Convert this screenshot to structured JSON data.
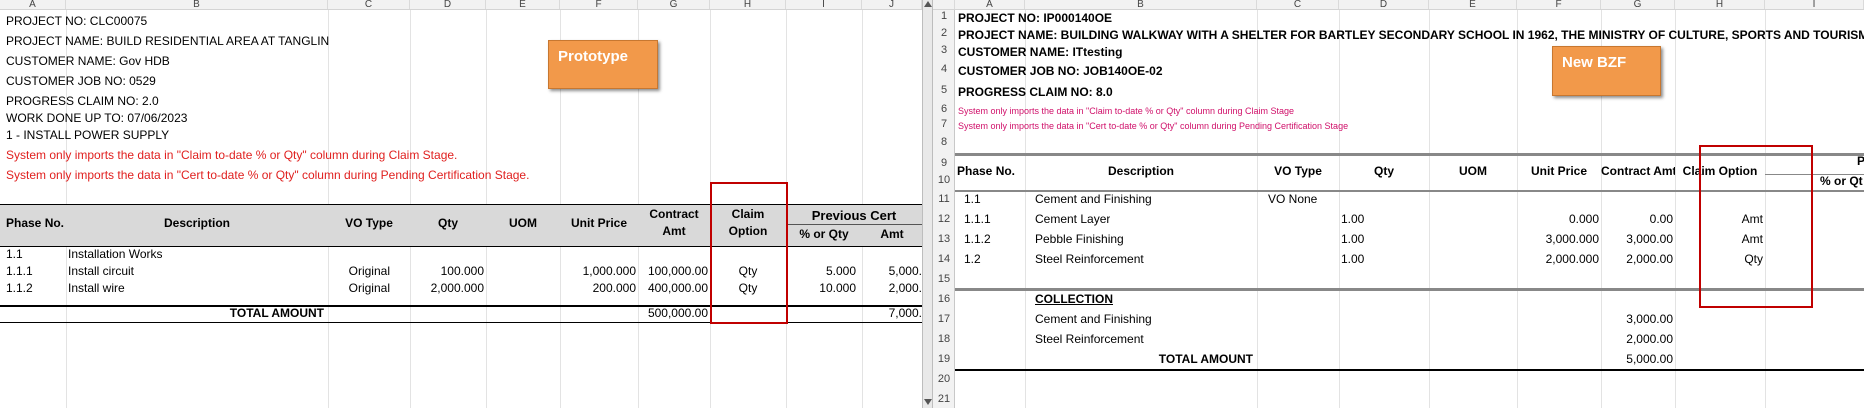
{
  "left": {
    "columns": [
      "A",
      "B",
      "C",
      "D",
      "E",
      "F",
      "G",
      "H",
      "I",
      "J"
    ],
    "info": [
      "PROJECT NO: CLC00075",
      "PROJECT NAME: BUILD RESIDENTIAL AREA AT TANGLIN",
      "CUSTOMER NAME: Gov HDB",
      "CUSTOMER JOB NO: 0529",
      "PROGRESS CLAIM NO: 2.0",
      "WORK DONE UP TO: 07/06/2023",
      "1 - INSTALL POWER SUPPLY"
    ],
    "notes": [
      "System only imports the data in \"Claim to-date % or Qty\" column during Claim Stage.",
      "System only imports the data in \"Cert to-date % or Qty\" column during Pending Certification Stage."
    ],
    "callout": "Prototype",
    "headers": {
      "phase": "Phase No.",
      "description": "Description",
      "vo_type": "VO Type",
      "qty": "Qty",
      "uom": "UOM",
      "unit_price": "Unit Price",
      "contract_1": "Contract",
      "contract_2": "Amt",
      "claim_1": "Claim",
      "claim_2": "Option",
      "prev_cert": "Previous Cert",
      "pct_qty": "% or Qty",
      "amt": "Amt"
    },
    "rows": [
      {
        "phase": "1.1",
        "description": "Installation Works",
        "vo_type": "",
        "qty": "",
        "uom": "",
        "unit_price": "",
        "contract_amt": "",
        "claim_option": "",
        "pct": "",
        "amt": ""
      },
      {
        "phase": "1.1.1",
        "description": "Install circuit",
        "vo_type": "Original",
        "qty": "100.000",
        "uom": "",
        "unit_price": "1,000.000",
        "contract_amt": "100,000.00",
        "claim_option": "Qty",
        "pct": "5.000",
        "amt": "5,000."
      },
      {
        "phase": "1.1.2",
        "description": "Install wire",
        "vo_type": "Original",
        "qty": "2,000.000",
        "uom": "",
        "unit_price": "200.000",
        "contract_amt": "400,000.00",
        "claim_option": "Qty",
        "pct": "10.000",
        "amt": "2,000."
      }
    ],
    "total_label": "TOTAL AMOUNT",
    "total_contract": "500,000.00",
    "total_amt": "7,000."
  },
  "right": {
    "columns": [
      "A",
      "B",
      "C",
      "D",
      "E",
      "F",
      "G",
      "H",
      "I"
    ],
    "row_numbers": [
      "1",
      "2",
      "3",
      "4",
      "5",
      "6",
      "7",
      "8",
      "9",
      "10",
      "11",
      "12",
      "13",
      "14",
      "15",
      "16",
      "17",
      "18",
      "19",
      "20",
      "21"
    ],
    "info": [
      "PROJECT NO: IP000140OE",
      "PROJECT NAME: BUILDING WALKWAY WITH A SHELTER FOR BARTLEY SECONDARY SCHOOL IN 1962, THE MINISTRY OF CULTURE, SPORTS AND TOURISM OF NOR",
      "CUSTOMER NAME: ITtesting",
      "CUSTOMER JOB NO: JOB140OE-02",
      "PROGRESS CLAIM NO: 8.0"
    ],
    "notes": [
      "System only imports the data in \"Claim to-date % or Qty\" column during Claim Stage",
      "System only imports the data in \"Cert to-date % or Qty\" column during Pending Certification Stage"
    ],
    "callout": "New BZF",
    "headers": {
      "phase": "Phase No.",
      "description": "Description",
      "vo_type": "VO Type",
      "qty": "Qty",
      "uom": "UOM",
      "unit_price": "Unit Price",
      "contract_amt": "Contract Amt",
      "claim_option": "Claim Option",
      "i_top": "P",
      "i_bottom": "% or Qt"
    },
    "rows": [
      {
        "phase": "1.1",
        "description": "Cement and Finishing",
        "vo_type": "VO None",
        "qty": "",
        "unit_price": "",
        "contract_amt": "",
        "claim_option": ""
      },
      {
        "phase": "1.1.1",
        "description": "Cement Layer",
        "vo_type": "",
        "qty": "1.00",
        "unit_price": "0.000",
        "contract_amt": "0.00",
        "claim_option": "Amt"
      },
      {
        "phase": "1.1.2",
        "description": "Pebble Finishing",
        "vo_type": "",
        "qty": "1.00",
        "unit_price": "3,000.000",
        "contract_amt": "3,000.00",
        "claim_option": "Amt"
      },
      {
        "phase": "1.2",
        "description": "Steel Reinforcement",
        "vo_type": "",
        "qty": "1.00",
        "unit_price": "2,000.000",
        "contract_amt": "2,000.00",
        "claim_option": "Qty"
      }
    ],
    "collection_label": "COLLECTION",
    "collection": [
      {
        "description": "Cement and Finishing",
        "amount": "3,000.00"
      },
      {
        "description": "Steel Reinforcement",
        "amount": "2,000.00"
      }
    ],
    "total_label": "TOTAL AMOUNT",
    "total_amount": "5,000.00"
  }
}
